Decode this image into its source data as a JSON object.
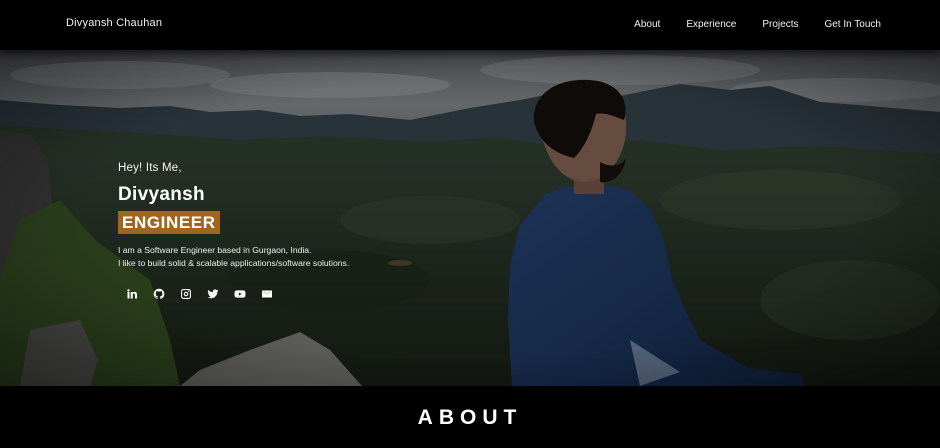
{
  "nav": {
    "brand": "Divyansh Chauhan",
    "links": [
      {
        "label": "About"
      },
      {
        "label": "Experience"
      },
      {
        "label": "Projects"
      },
      {
        "label": "Get In Touch"
      }
    ]
  },
  "hero": {
    "greeting": "Hey! Its Me,",
    "name": "Divyansh",
    "role": "ENGINEER",
    "description_line1": "I am a Software Engineer based in Gurgaon, India.",
    "description_line2": "I like to build solid & scalable applications/software solutions.",
    "social_icons": [
      "linkedin-icon",
      "github-icon",
      "instagram-icon",
      "twitter-icon",
      "youtube-icon",
      "email-icon"
    ],
    "accent_color": "#a0651e"
  },
  "about": {
    "heading": "ABOUT"
  }
}
